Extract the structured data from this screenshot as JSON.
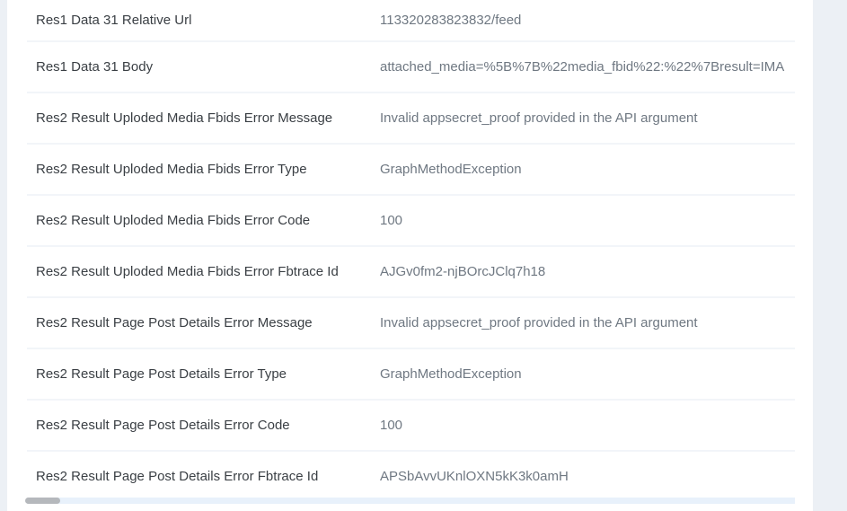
{
  "rows": [
    {
      "key": "Res1 Data 31 Relative Url",
      "value": "113320283823832/feed"
    },
    {
      "key": "Res1 Data 31 Body",
      "value": "attached_media=%5B%7B%22media_fbid%22:%22%7Bresult=IMA"
    },
    {
      "key": "Res2 Result Uploded Media Fbids Error Message",
      "value": "Invalid appsecret_proof provided in the API argument"
    },
    {
      "key": "Res2 Result Uploded Media Fbids Error Type",
      "value": "GraphMethodException"
    },
    {
      "key": "Res2 Result Uploded Media Fbids Error Code",
      "value": "100"
    },
    {
      "key": "Res2 Result Uploded Media Fbids Error Fbtrace Id",
      "value": "AJGv0fm2-njBOrcJClq7h18"
    },
    {
      "key": "Res2 Result Page Post Details Error Message",
      "value": "Invalid appsecret_proof provided in the API argument"
    },
    {
      "key": "Res2 Result Page Post Details Error Type",
      "value": "GraphMethodException"
    },
    {
      "key": "Res2 Result Page Post Details Error Code",
      "value": "100"
    },
    {
      "key": "Res2 Result Page Post Details Error Fbtrace Id",
      "value": "APSbAvvUKnlOXN5kK3k0amH"
    }
  ]
}
